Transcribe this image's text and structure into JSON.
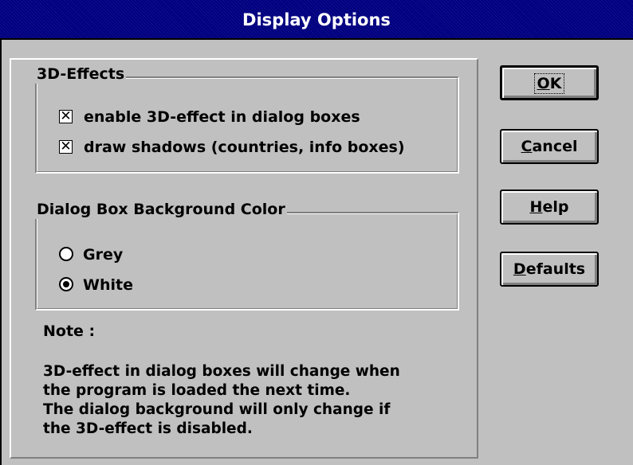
{
  "window": {
    "title": "Display Options"
  },
  "effects_group": {
    "label": "3D-Effects",
    "options": [
      {
        "label": "enable 3D-effect in dialog boxes",
        "checked": true
      },
      {
        "label": "draw shadows (countries, info boxes)",
        "checked": true
      }
    ]
  },
  "background_group": {
    "label": "Dialog Box Background Color",
    "options": [
      {
        "label": "Grey",
        "selected": false
      },
      {
        "label": "White",
        "selected": true
      }
    ]
  },
  "note": {
    "heading": "Note :",
    "text": "3D-effect in dialog boxes will change when\nthe program is loaded the next time.\nThe dialog background will only change if\nthe 3D-effect is disabled."
  },
  "buttons": {
    "ok": {
      "mnemonic": "O",
      "rest": "K"
    },
    "cancel": {
      "mnemonic": "C",
      "rest": "ancel"
    },
    "help": {
      "mnemonic": "H",
      "rest": "elp"
    },
    "defaults": {
      "mnemonic": "D",
      "rest": "efaults"
    }
  },
  "colors": {
    "title_bar": "#000080",
    "face": "#c0c0c0",
    "shadow": "#808080",
    "highlight": "#ffffff"
  }
}
